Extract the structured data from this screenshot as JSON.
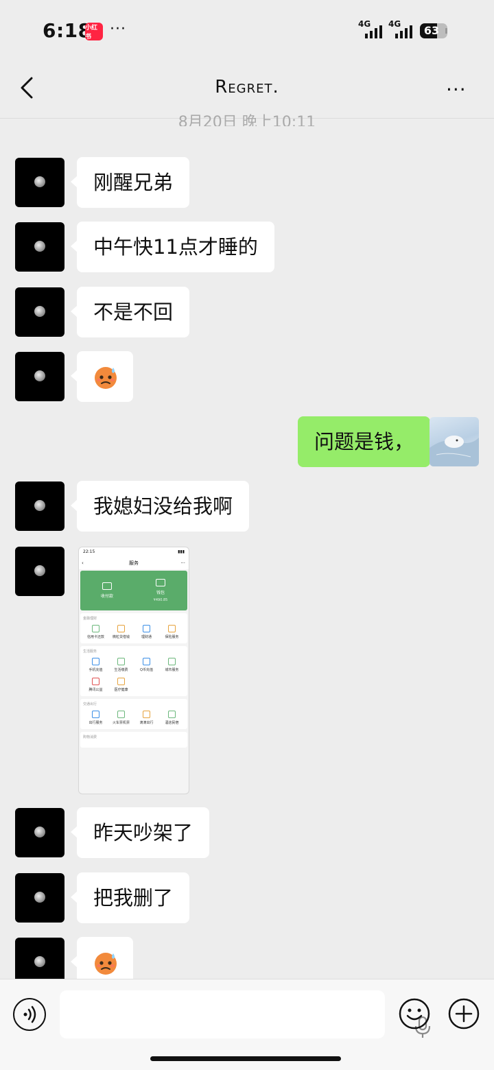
{
  "status_bar": {
    "time": "6:18",
    "app_badge": "小红书",
    "more": "···",
    "signal1_label": "4G",
    "signal2_label": "4G",
    "battery": "63",
    "battery_level": 0.63
  },
  "header": {
    "title": "Regret.",
    "more": "···"
  },
  "date_separator": "8月20日 晚上10:11",
  "messages": [
    {
      "side": "left",
      "type": "text",
      "text": "刚醒兄弟"
    },
    {
      "side": "left",
      "type": "text",
      "text": "中午快11点才睡的"
    },
    {
      "side": "left",
      "type": "text",
      "text": "不是不回"
    },
    {
      "side": "left",
      "type": "emoji",
      "emoji": "sweat-face-emoji"
    },
    {
      "side": "right",
      "type": "text",
      "text": "问题是钱，"
    },
    {
      "side": "left",
      "type": "text",
      "text": "我媳妇没给我啊"
    },
    {
      "side": "left",
      "type": "image"
    },
    {
      "side": "left",
      "type": "text",
      "text": "昨天吵架了"
    },
    {
      "side": "left",
      "type": "text",
      "text": "把我删了"
    },
    {
      "side": "left",
      "type": "emoji",
      "emoji": "sweat-face-emoji"
    }
  ],
  "screenshot": {
    "status_time": "22:15",
    "page_title": "服务",
    "pay_label": "收付款",
    "wallet_label": "钱包",
    "wallet_amount": "¥490.85",
    "sections": [
      {
        "title": "金融理财",
        "items": [
          "信用卡还款",
          "微粒贷借钱",
          "理财通",
          "保险服务"
        ]
      },
      {
        "title": "生活服务",
        "items": [
          "手机充值",
          "生活缴费",
          "Q币充值",
          "城市服务",
          "腾讯公益",
          "医疗健康"
        ]
      },
      {
        "title": "交通出行",
        "items": [
          "出行服务",
          "火车票机票",
          "滴滴出行",
          "酒店民宿"
        ]
      },
      {
        "title": "购物消费",
        "items": []
      }
    ]
  },
  "input_bar": {
    "placeholder": ""
  }
}
